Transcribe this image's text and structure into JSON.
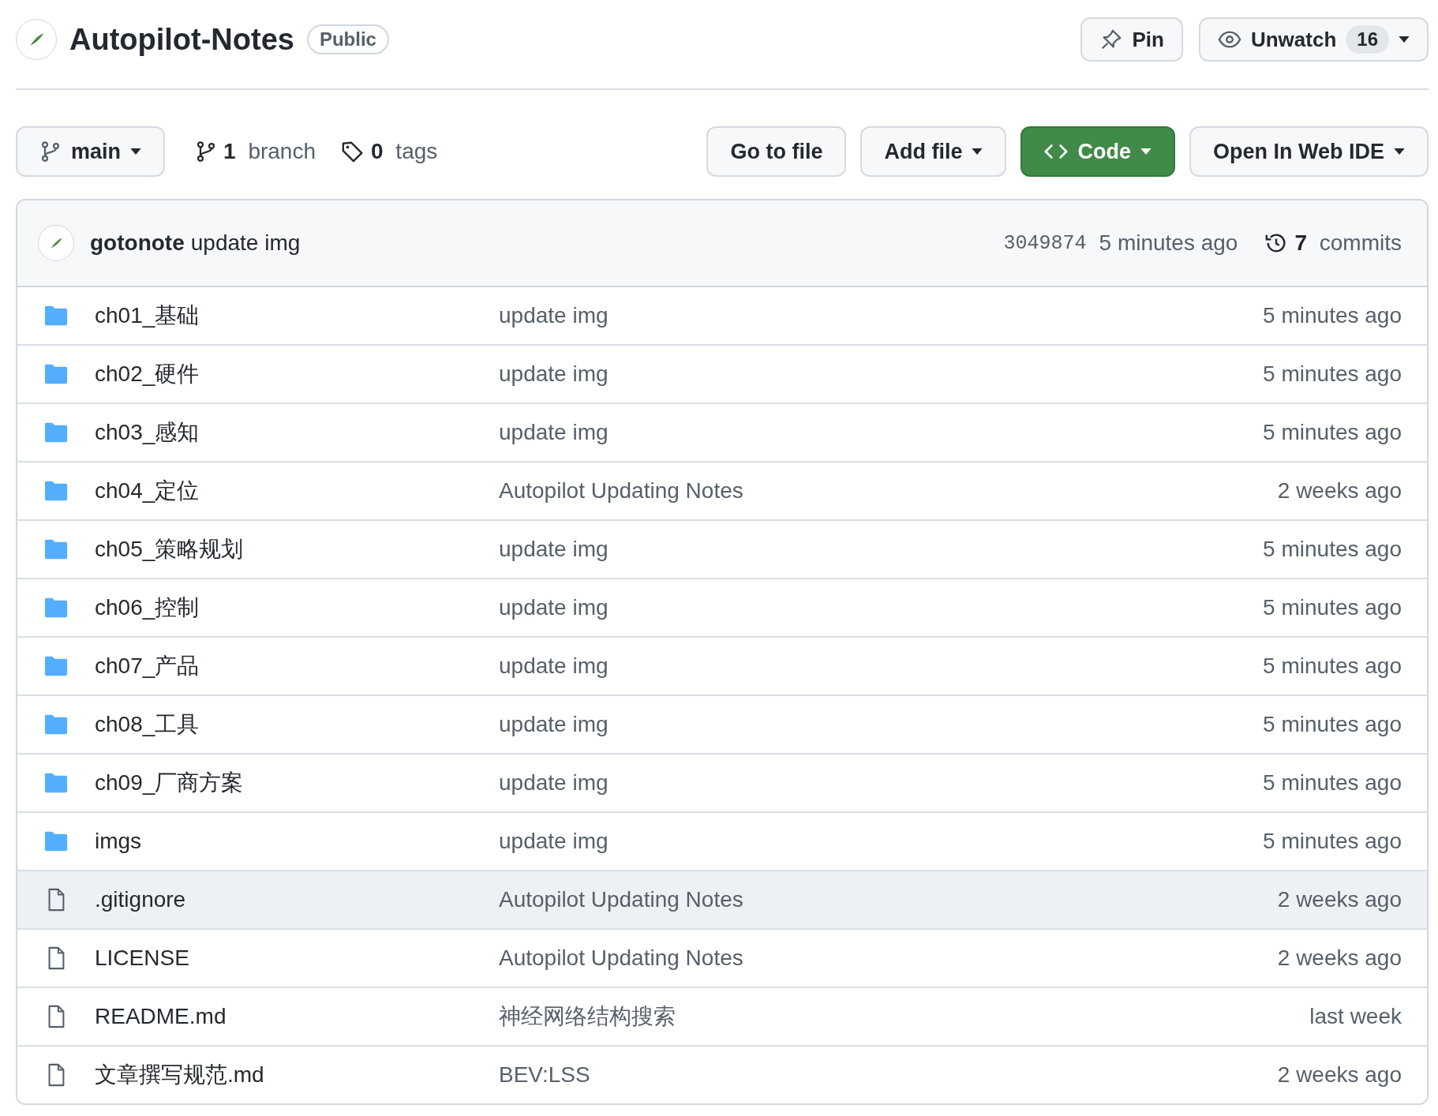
{
  "repo": {
    "name": "Autopilot-Notes",
    "visibility": "Public"
  },
  "header_actions": {
    "pin": "Pin",
    "watch": {
      "label": "Unwatch",
      "count": "16"
    }
  },
  "branch_selector": "main",
  "branches": {
    "count": "1",
    "label": "branch"
  },
  "tags": {
    "count": "0",
    "label": "tags"
  },
  "buttons": [
    {
      "label": "Go to file",
      "kind": "plain"
    },
    {
      "label": "Add file",
      "kind": "dropdown"
    },
    {
      "label": "Code",
      "kind": "primary"
    },
    {
      "label": "Open In Web IDE",
      "kind": "dropdown"
    }
  ],
  "latest_commit": {
    "author": "gotonote",
    "message": "update img",
    "sha": "3049874",
    "time": "5 minutes ago",
    "commits_count": "7",
    "commits_label": "commits"
  },
  "files": [
    {
      "kind": "folder",
      "name": "ch01_基础",
      "message": "update img",
      "time": "5 minutes ago",
      "hovered": false
    },
    {
      "kind": "folder",
      "name": "ch02_硬件",
      "message": "update img",
      "time": "5 minutes ago",
      "hovered": false
    },
    {
      "kind": "folder",
      "name": "ch03_感知",
      "message": "update img",
      "time": "5 minutes ago",
      "hovered": false
    },
    {
      "kind": "folder",
      "name": "ch04_定位",
      "message": "Autopilot Updating Notes",
      "time": "2 weeks ago",
      "hovered": false
    },
    {
      "kind": "folder",
      "name": "ch05_策略规划",
      "message": "update img",
      "time": "5 minutes ago",
      "hovered": false
    },
    {
      "kind": "folder",
      "name": "ch06_控制",
      "message": "update img",
      "time": "5 minutes ago",
      "hovered": false
    },
    {
      "kind": "folder",
      "name": "ch07_产品",
      "message": "update img",
      "time": "5 minutes ago",
      "hovered": false
    },
    {
      "kind": "folder",
      "name": "ch08_工具",
      "message": "update img",
      "time": "5 minutes ago",
      "hovered": false
    },
    {
      "kind": "folder",
      "name": "ch09_厂商方案",
      "message": "update img",
      "time": "5 minutes ago",
      "hovered": false
    },
    {
      "kind": "folder",
      "name": "imgs",
      "message": "update img",
      "time": "5 minutes ago",
      "hovered": false
    },
    {
      "kind": "file",
      "name": ".gitignore",
      "message": "Autopilot Updating Notes",
      "time": "2 weeks ago",
      "hovered": true
    },
    {
      "kind": "file",
      "name": "LICENSE",
      "message": "Autopilot Updating Notes",
      "time": "2 weeks ago",
      "hovered": false
    },
    {
      "kind": "file",
      "name": "README.md",
      "message": "神经网络结构搜索",
      "time": "last week",
      "hovered": false
    },
    {
      "kind": "file",
      "name": "文章撰写规范.md",
      "message": "BEV:LSS",
      "time": "2 weeks ago",
      "hovered": false
    }
  ]
}
